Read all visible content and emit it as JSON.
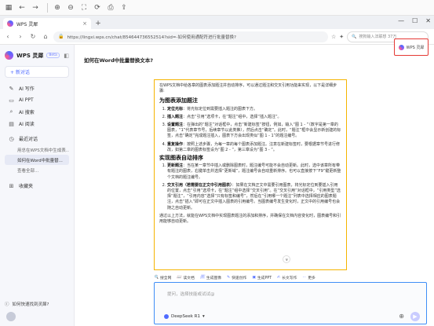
{
  "toolbar": {
    "icons": [
      "grid-icon",
      "arrow-left-icon",
      "arrow-right-icon",
      "zoom-in-icon",
      "zoom-out-icon",
      "fit-icon",
      "rotate-icon",
      "save-icon",
      "export-icon"
    ]
  },
  "browser": {
    "tab_title": "WPS 灵犀",
    "tab_close": "×",
    "new_tab": "+",
    "url": "https://lingxi.wps.cn/chat/854644736552514?sid=-如何使用通配符进行批量替换?",
    "search_placeholder": "搜狗输入法联想 37万"
  },
  "sidebar": {
    "brand": "WPS 灵犀",
    "beta": "Beta",
    "new_chat": "+ 新对话",
    "items": [
      {
        "label": "AI 写作"
      },
      {
        "label": "AI PPT"
      },
      {
        "label": "AI 搜索"
      },
      {
        "label": "AI 阅读"
      }
    ],
    "recent_label": "最近对话",
    "recent": [
      {
        "label": "用总在WPS文档中生成表..."
      },
      {
        "label": "如何在Word中批量替..."
      },
      {
        "label": "查看全部..."
      }
    ],
    "favorites": "收藏夹",
    "bottom_link": "如何快速找到灵犀?"
  },
  "main": {
    "title": "如何在Word中批量替换文本?",
    "chip_label": "WPS 灵犀",
    "answer": {
      "intro": "在WPS文档中给各章的图表添加题注并自动排序，可以通过题注和交叉引用功能来实现，以下是详细步骤:",
      "section1": "为图表添加题注",
      "steps1": [
        {
          "bold": "定位光标",
          "text": "：将光标定位到需要插入题注的图表下方。"
        },
        {
          "bold": "插入题注",
          "text": "：点击“引用”选项卡，在“题注”组中，选择“插入题注”。"
        },
        {
          "bold": "设置题注",
          "text": "：在弹出的“题注”对话框中，点击“新建标签”按钮，例如，输入“图 1 - ”（数字是第一章的图表，“1”代表章节号，后续章节以此类推），然后点击“确定”。此时，“题注”框中会显示新创建的标签，点击“确定”完成题注插入，图表下方会出现类似“图 1 - 1”的题注编号。"
        },
        {
          "bold": "重复操作",
          "text": "：按照上述步骤，为每一章的每个图表添加题注。注意在新建标签时，要根据章节号进行修改，如第二章的图表标签设为“图 2 - ”，第三章设为“图 3 - ”。"
        }
      ],
      "section2": "实现图表自动排序",
      "steps2": [
        {
          "bold": "更新题注",
          "text": "：当在某一章节中插入或删除图表时，题注编号可能不会自动更新。此时，选中该章所有带有题注的图表，右键单击并选择“更新域”，题注编号会自动重新排序。也可以直接按下“F9”键更新整个文档的题注编号。"
        },
        {
          "bold": "交叉引用（若需要在正文中引用图表）",
          "text": "：如果在文档正文中需要引用图表，将光标定位到要插入引用的位置，点击“引用”选项卡，在“题注”组中选择“交叉引用”。在“交叉引用”对话框中，“引用类型”选择“题注”，“引用内容”选择“只有标签和编号”，然后在“引用哪一个题注”列表中选择相应的图表题注，点击“插入”即可在正文中插入图表的引用编号。当图表编号发生变化时，正文中的引用编号也会随之自动更新。"
        }
      ],
      "outro": "通过以上方法，就能在WPS文档中实现图表题注的添加和排序，并确保在文档内容变化时，图表编号和引用能够自动更新。",
      "scroll_hint": "»"
    },
    "tools": [
      {
        "icon": "🔍",
        "label": "搜全网"
      },
      {
        "icon": "📖",
        "label": "读文档"
      },
      {
        "icon": "🖼",
        "label": "生成图像"
      },
      {
        "icon": "✎",
        "label": "快速创作"
      },
      {
        "icon": "▣",
        "label": "生成PPT"
      },
      {
        "icon": "✍",
        "label": "长文写作"
      },
      {
        "icon": "⋯",
        "label": "更多"
      }
    ],
    "input": {
      "placeholder": "提问，选择技能或试试@",
      "model": "DeepSeek R1",
      "model_arrow": "▾"
    }
  }
}
